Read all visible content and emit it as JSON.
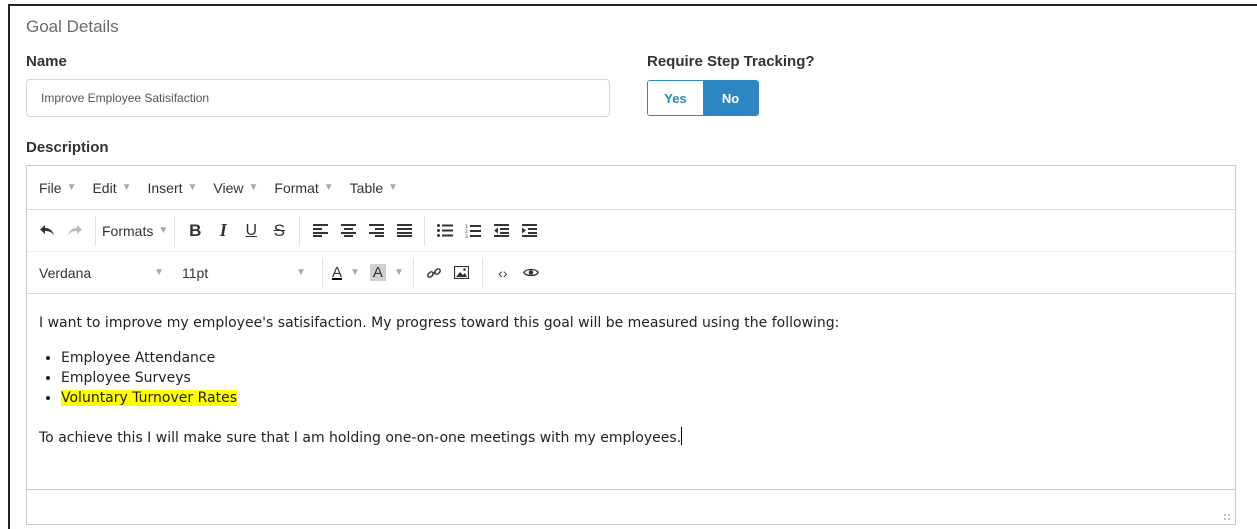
{
  "section_title": "Goal Details",
  "name": {
    "label": "Name",
    "value": "Improve Employee Satisifaction"
  },
  "step_tracking": {
    "label": "Require Step Tracking?",
    "options": [
      "Yes",
      "No"
    ],
    "selected": "No"
  },
  "description": {
    "label": "Description",
    "menubar": [
      "File",
      "Edit",
      "Insert",
      "View",
      "Format",
      "Table"
    ],
    "toolbar": {
      "formats_label": "Formats",
      "font_family": "Verdana",
      "font_size": "11pt"
    },
    "content": {
      "intro": "I want to improve my employee's satisifaction.  My progress toward this goal will be measured using the following:",
      "bullets": [
        "Employee Attendance",
        "Employee Surveys",
        "Voluntary Turnover Rates"
      ],
      "closing": "To achieve this I will make sure that I am holding one-on-one meetings with my employees."
    }
  },
  "colors": {
    "accent": "#2e86c1",
    "highlight": "#ffff00"
  }
}
